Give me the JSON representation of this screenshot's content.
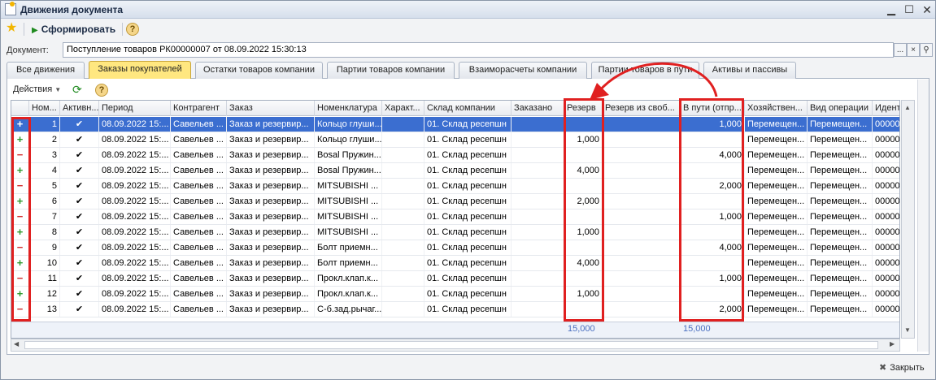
{
  "window": {
    "title": "Движения документа"
  },
  "toolbar": {
    "run_label": "Сформировать",
    "help": "?"
  },
  "document": {
    "label": "Документ:",
    "value": "Поступление товаров РК00000007 от 08.09.2022 15:30:13",
    "select_btn": "...",
    "clear_btn": "×",
    "search_btn": "⚲"
  },
  "tabs": [
    "Все движения",
    "Заказы покупателей",
    "Остатки товаров компании",
    "Партии товаров компании",
    "Взаиморасчеты компании",
    "Партии товаров в пути",
    "Активы и пассивы"
  ],
  "active_tab": 1,
  "panel": {
    "actions_label": "Действия",
    "help": "?"
  },
  "table": {
    "columns": [
      "",
      "Ном...",
      "Активн...",
      "Период",
      "Контрагент",
      "Заказ",
      "Номенклатура",
      "Характ...",
      "Склад компании",
      "Заказано",
      "Резерв",
      "Резерв из своб...",
      "В пути (отпр...",
      "Хозяйствен...",
      "Вид операции",
      "Идент"
    ],
    "rows": [
      {
        "sign": "+",
        "n": "1",
        "active": "✔",
        "period": "08.09.2022 15:...",
        "contr": "Савельев ...",
        "order": "Заказ и резервир...",
        "item": "Кольцо глуши...",
        "char": "",
        "store": "01. Склад ресепшн",
        "ordered": "",
        "reserve": "",
        "free": "",
        "transit": "1,000",
        "biz": "Перемещен...",
        "op": "Перемещен...",
        "id": "00000"
      },
      {
        "sign": "+",
        "n": "2",
        "active": "✔",
        "period": "08.09.2022 15:...",
        "contr": "Савельев ...",
        "order": "Заказ и резервир...",
        "item": "Кольцо глуши...",
        "char": "",
        "store": "01. Склад ресепшн",
        "ordered": "",
        "reserve": "1,000",
        "free": "",
        "transit": "",
        "biz": "Перемещен...",
        "op": "Перемещен...",
        "id": "00000"
      },
      {
        "sign": "−",
        "n": "3",
        "active": "✔",
        "period": "08.09.2022 15:...",
        "contr": "Савельев ...",
        "order": "Заказ и резервир...",
        "item": "Bosal Пружин...",
        "char": "",
        "store": "01. Склад ресепшн",
        "ordered": "",
        "reserve": "",
        "free": "",
        "transit": "4,000",
        "biz": "Перемещен...",
        "op": "Перемещен...",
        "id": "00000"
      },
      {
        "sign": "+",
        "n": "4",
        "active": "✔",
        "period": "08.09.2022 15:...",
        "contr": "Савельев ...",
        "order": "Заказ и резервир...",
        "item": "Bosal Пружин...",
        "char": "",
        "store": "01. Склад ресепшн",
        "ordered": "",
        "reserve": "4,000",
        "free": "",
        "transit": "",
        "biz": "Перемещен...",
        "op": "Перемещен...",
        "id": "00000"
      },
      {
        "sign": "−",
        "n": "5",
        "active": "✔",
        "period": "08.09.2022 15:...",
        "contr": "Савельев ...",
        "order": "Заказ и резервир...",
        "item": "MITSUBISHI ...",
        "char": "",
        "store": "01. Склад ресепшн",
        "ordered": "",
        "reserve": "",
        "free": "",
        "transit": "2,000",
        "biz": "Перемещен...",
        "op": "Перемещен...",
        "id": "00000"
      },
      {
        "sign": "+",
        "n": "6",
        "active": "✔",
        "period": "08.09.2022 15:...",
        "contr": "Савельев ...",
        "order": "Заказ и резервир...",
        "item": "MITSUBISHI ...",
        "char": "",
        "store": "01. Склад ресепшн",
        "ordered": "",
        "reserve": "2,000",
        "free": "",
        "transit": "",
        "biz": "Перемещен...",
        "op": "Перемещен...",
        "id": "00000"
      },
      {
        "sign": "−",
        "n": "7",
        "active": "✔",
        "period": "08.09.2022 15:...",
        "contr": "Савельев ...",
        "order": "Заказ и резервир...",
        "item": "MITSUBISHI ...",
        "char": "",
        "store": "01. Склад ресепшн",
        "ordered": "",
        "reserve": "",
        "free": "",
        "transit": "1,000",
        "biz": "Перемещен...",
        "op": "Перемещен...",
        "id": "00000"
      },
      {
        "sign": "+",
        "n": "8",
        "active": "✔",
        "period": "08.09.2022 15:...",
        "contr": "Савельев ...",
        "order": "Заказ и резервир...",
        "item": "MITSUBISHI ...",
        "char": "",
        "store": "01. Склад ресепшн",
        "ordered": "",
        "reserve": "1,000",
        "free": "",
        "transit": "",
        "biz": "Перемещен...",
        "op": "Перемещен...",
        "id": "00000"
      },
      {
        "sign": "−",
        "n": "9",
        "active": "✔",
        "period": "08.09.2022 15:...",
        "contr": "Савельев ...",
        "order": "Заказ и резервир...",
        "item": "Болт приемн...",
        "char": "",
        "store": "01. Склад ресепшн",
        "ordered": "",
        "reserve": "",
        "free": "",
        "transit": "4,000",
        "biz": "Перемещен...",
        "op": "Перемещен...",
        "id": "00000"
      },
      {
        "sign": "+",
        "n": "10",
        "active": "✔",
        "period": "08.09.2022 15:...",
        "contr": "Савельев ...",
        "order": "Заказ и резервир...",
        "item": "Болт приемн...",
        "char": "",
        "store": "01. Склад ресепшн",
        "ordered": "",
        "reserve": "4,000",
        "free": "",
        "transit": "",
        "biz": "Перемещен...",
        "op": "Перемещен...",
        "id": "00000"
      },
      {
        "sign": "−",
        "n": "11",
        "active": "✔",
        "period": "08.09.2022 15:...",
        "contr": "Савельев ...",
        "order": "Заказ и резервир...",
        "item": "Прокл.клап.к...",
        "char": "",
        "store": "01. Склад ресепшн",
        "ordered": "",
        "reserve": "",
        "free": "",
        "transit": "1,000",
        "biz": "Перемещен...",
        "op": "Перемещен...",
        "id": "00000"
      },
      {
        "sign": "+",
        "n": "12",
        "active": "✔",
        "period": "08.09.2022 15:...",
        "contr": "Савельев ...",
        "order": "Заказ и резервир...",
        "item": "Прокл.клап.к...",
        "char": "",
        "store": "01. Склад ресепшн",
        "ordered": "",
        "reserve": "1,000",
        "free": "",
        "transit": "",
        "biz": "Перемещен...",
        "op": "Перемещен...",
        "id": "00000"
      },
      {
        "sign": "−",
        "n": "13",
        "active": "✔",
        "period": "08.09.2022 15:...",
        "contr": "Савельев ...",
        "order": "Заказ и резервир...",
        "item": "С-б.зад.рычаг...",
        "char": "",
        "store": "01. Склад ресепшн",
        "ordered": "",
        "reserve": "",
        "free": "",
        "transit": "2,000",
        "biz": "Перемещен...",
        "op": "Перемещен...",
        "id": "00000"
      }
    ],
    "totals": {
      "reserve": "15,000",
      "transit": "15,000"
    }
  },
  "footer": {
    "close_label": "Закрыть"
  },
  "colors": {
    "selection": "#3b6ed0",
    "highlight": "#e02020",
    "active_tab": "#ffe780",
    "plus": "#2e9a2e",
    "minus": "#d23030"
  }
}
